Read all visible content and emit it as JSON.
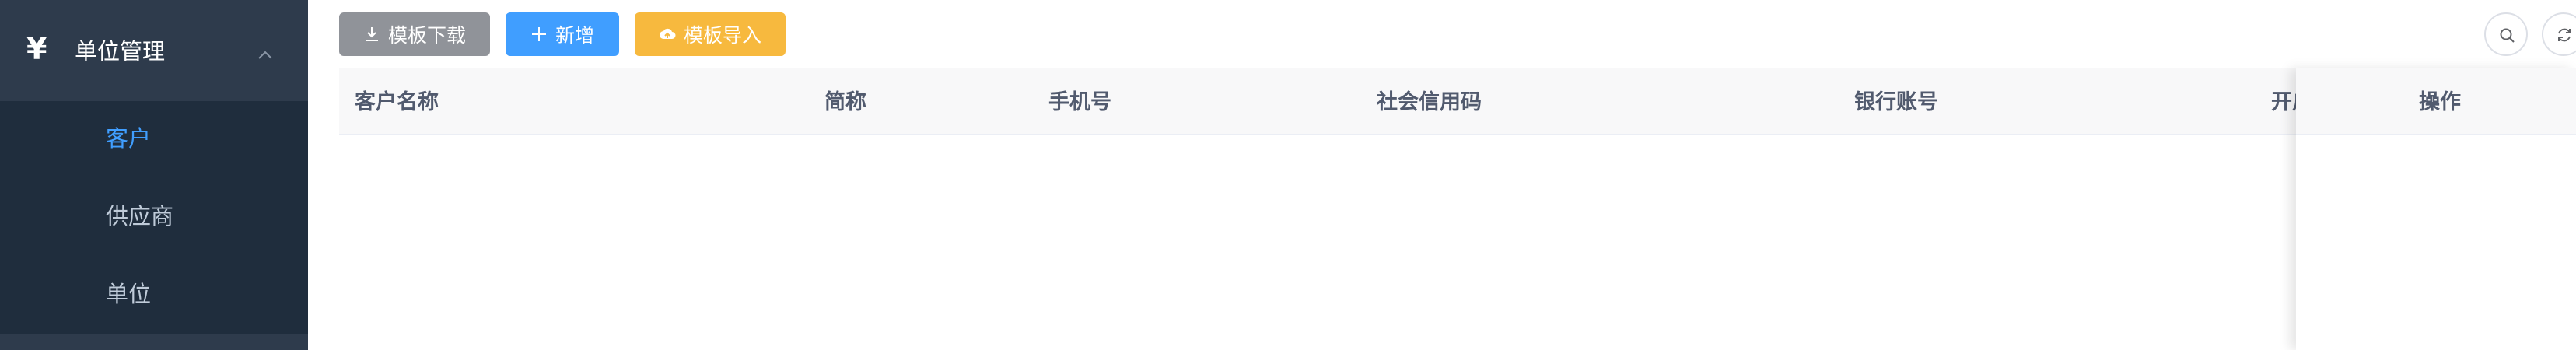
{
  "sidebar": {
    "group": {
      "icon": "yen-icon",
      "yen_symbol": "¥",
      "label": "单位管理",
      "expanded": true
    },
    "items": [
      {
        "label": "客户",
        "active": true
      },
      {
        "label": "供应商",
        "active": false
      },
      {
        "label": "单位",
        "active": false
      }
    ]
  },
  "toolbar": {
    "download_label": "模板下载",
    "add_label": "新增",
    "import_label": "模板导入"
  },
  "table": {
    "columns": [
      "客户名称",
      "简称",
      "手机号",
      "社会信用码",
      "银行账号",
      "开户"
    ],
    "action_column": "操作",
    "rows": []
  },
  "colors": {
    "sidebar_bg": "#1f2d3d",
    "sidebar_group_bg": "#2e3b4c",
    "active_text": "#409eff",
    "btn_download": "#909399",
    "btn_add": "#409eff",
    "btn_import": "#f7b93e"
  }
}
